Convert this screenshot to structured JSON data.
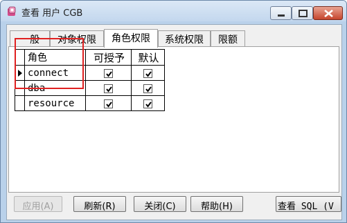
{
  "window": {
    "title": "查看 用户 CGB"
  },
  "tabs": [
    {
      "label": "一般"
    },
    {
      "label": "对象权限"
    },
    {
      "label": "角色权限"
    },
    {
      "label": "系统权限"
    },
    {
      "label": "限额"
    }
  ],
  "grid": {
    "headers": {
      "role": "角色",
      "grantable": "可授予",
      "default": "默认"
    },
    "rows": [
      {
        "role": "connect",
        "grantable": true,
        "default": true
      },
      {
        "role": "dba",
        "grantable": true,
        "default": true
      },
      {
        "role": "resource",
        "grantable": true,
        "default": true
      }
    ]
  },
  "buttons": {
    "apply": "应用(A)",
    "refresh": "刷新(R)",
    "close": "关闭(C)",
    "help": "帮助(H)",
    "view_sql": "查看 SQL (V"
  },
  "colors": {
    "highlight": "#e02020"
  }
}
